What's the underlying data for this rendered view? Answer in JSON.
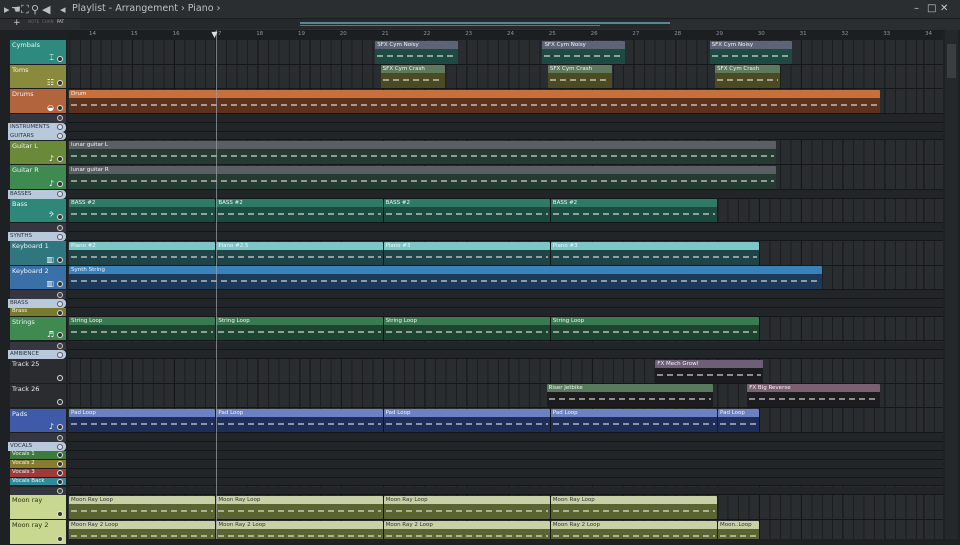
{
  "titlebar": {
    "title": "Playlist - Arrangement › Piano ›",
    "toolbar_labels": [
      "NOTE",
      "CHAN",
      "PAT"
    ]
  },
  "ruler": {
    "bars": [
      14,
      15,
      16,
      17,
      18,
      19,
      20,
      21,
      22,
      23,
      24,
      25,
      26,
      27,
      28,
      29,
      30,
      31,
      32,
      33,
      34
    ]
  },
  "playhead_bar": 17,
  "tracks": [
    {
      "kind": "track",
      "name": "Cymbals",
      "color": "#2e8a7e",
      "icon": "cymbal-icon",
      "glyph": "⌶"
    },
    {
      "kind": "track",
      "name": "Toms",
      "color": "#8a8a3c",
      "icon": "toms-icon",
      "glyph": "☷"
    },
    {
      "kind": "track",
      "name": "Drums",
      "color": "#b2643c",
      "icon": "drum-icon",
      "glyph": "◒"
    },
    {
      "kind": "spacer"
    },
    {
      "kind": "group",
      "name": "INSTRUMENTS"
    },
    {
      "kind": "group",
      "name": "GUITARS"
    },
    {
      "kind": "track",
      "name": "Guitar L",
      "color": "#6a8a3a",
      "icon": "guitar-icon",
      "glyph": "♪"
    },
    {
      "kind": "track",
      "name": "Guitar R",
      "color": "#3f8a50",
      "icon": "guitar-icon",
      "glyph": "♪"
    },
    {
      "kind": "group",
      "name": "BASSES"
    },
    {
      "kind": "track",
      "name": "Bass",
      "color": "#2f877a",
      "icon": "bass-clef-icon",
      "glyph": "𝄢"
    },
    {
      "kind": "spacer"
    },
    {
      "kind": "group",
      "name": "SYNTHS"
    },
    {
      "kind": "track",
      "name": "Keyboard 1",
      "color": "#2f767e",
      "icon": "keyboard-icon",
      "glyph": "▥"
    },
    {
      "kind": "track",
      "name": "Keyboard 2",
      "color": "#3a70a8",
      "icon": "keyboard-icon",
      "glyph": "▥"
    },
    {
      "kind": "spacer"
    },
    {
      "kind": "group",
      "name": "BRASS"
    },
    {
      "kind": "small",
      "name": "Brass",
      "color": "#7a7a2c"
    },
    {
      "kind": "track",
      "name": "Strings",
      "color": "#3f8a50",
      "icon": "violin-icon",
      "glyph": "♬"
    },
    {
      "kind": "spacer"
    },
    {
      "kind": "group",
      "name": "AMBIENCE"
    },
    {
      "kind": "track",
      "name": "Track 25",
      "color": "#2a2c2f"
    },
    {
      "kind": "track",
      "name": "Track 26",
      "color": "#2a2c2f"
    },
    {
      "kind": "track",
      "name": "Pads",
      "color": "#3f5aa8",
      "icon": "note-icon",
      "glyph": "♪"
    },
    {
      "kind": "spacer"
    },
    {
      "kind": "group",
      "name": "VOCALS"
    },
    {
      "kind": "small",
      "name": "Vocals 1",
      "color": "#3f7a3a"
    },
    {
      "kind": "small",
      "name": "Vocals 2",
      "color": "#8a7a2c"
    },
    {
      "kind": "small",
      "name": "Vocals 3",
      "color": "#a03a3a"
    },
    {
      "kind": "small",
      "name": "Vocals Back",
      "color": "#2f8a9a"
    },
    {
      "kind": "spacer"
    },
    {
      "kind": "track",
      "name": "Moon ray",
      "color": "#c8d890",
      "dark": true
    },
    {
      "kind": "track",
      "name": "Moon ray 2",
      "color": "#c8d890",
      "dark": true
    }
  ],
  "clips": [
    {
      "track": 0,
      "label": "SFX Cym Noisy",
      "start": 20.8,
      "end": 22.8,
      "hd": "#5e6478",
      "bd": "#1f4a44"
    },
    {
      "track": 0,
      "label": "SFX Cym Noisy",
      "start": 24.8,
      "end": 26.8,
      "hd": "#5e6478",
      "bd": "#1f4a44"
    },
    {
      "track": 0,
      "label": "SFX Cym Noisy",
      "start": 28.8,
      "end": 30.8,
      "hd": "#5e6478",
      "bd": "#1f4a44"
    },
    {
      "track": 1,
      "label": "SFX Cym Crash",
      "start": 20.93,
      "end": 22.5,
      "hd": "#5e7a5c",
      "bd": "#4c4a22"
    },
    {
      "track": 1,
      "label": "SFX Cym Crash",
      "start": 24.93,
      "end": 26.5,
      "hd": "#5e7a5c",
      "bd": "#4c4a22"
    },
    {
      "track": 1,
      "label": "SFX Cym Crash",
      "start": 28.93,
      "end": 30.5,
      "hd": "#5e7a5c",
      "bd": "#4c4a22"
    },
    {
      "track": 2,
      "label": "Drum",
      "start": 13.45,
      "end": 32.9,
      "hd": "#c8703c",
      "bd": "#5a321e"
    },
    {
      "track": 6,
      "label": "lunar guitar L",
      "start": 13.45,
      "end": 30.4,
      "hd": "#5a5f63",
      "bd": "#253a30"
    },
    {
      "track": 7,
      "label": "lunar guitar R",
      "start": 13.45,
      "end": 30.4,
      "hd": "#5a5f63",
      "bd": "#253a30"
    },
    {
      "track": 9,
      "label": "BASS #2",
      "start": 13.45,
      "end": 17,
      "hd": "#2f7a66",
      "bd": "#1c4a40"
    },
    {
      "track": 9,
      "label": "BASS #2",
      "start": 17,
      "end": 21,
      "hd": "#2f7a66",
      "bd": "#1c4a40"
    },
    {
      "track": 9,
      "label": "BASS #2",
      "start": 21,
      "end": 25,
      "hd": "#2f7a66",
      "bd": "#1c4a40"
    },
    {
      "track": 9,
      "label": "BASS #2",
      "start": 25,
      "end": 29,
      "hd": "#2f7a66",
      "bd": "#1c4a40"
    },
    {
      "track": 12,
      "label": "Piano #2",
      "start": 13.45,
      "end": 17,
      "hd": "#7cc6c8",
      "bd": "#1f4448"
    },
    {
      "track": 12,
      "label": "Piano #2.5",
      "start": 17,
      "end": 21,
      "hd": "#7cc6c8",
      "bd": "#1f4448"
    },
    {
      "track": 12,
      "label": "Piano #3",
      "start": 21,
      "end": 25,
      "hd": "#7cc6c8",
      "bd": "#1f4448"
    },
    {
      "track": 12,
      "label": "Piano #3",
      "start": 25,
      "end": 30,
      "hd": "#7cc6c8",
      "bd": "#1f4448"
    },
    {
      "track": 13,
      "label": "Synth String",
      "start": 13.45,
      "end": 31.5,
      "hd": "#3a82bc",
      "bd": "#1c3a58"
    },
    {
      "track": 17,
      "label": "String Loop",
      "start": 13.45,
      "end": 17,
      "hd": "#3a7a52",
      "bd": "#1e4430"
    },
    {
      "track": 17,
      "label": "String Loop",
      "start": 17,
      "end": 21,
      "hd": "#3a7a52",
      "bd": "#1e4430"
    },
    {
      "track": 17,
      "label": "String Loop",
      "start": 21,
      "end": 25,
      "hd": "#3a7a52",
      "bd": "#1e4430"
    },
    {
      "track": 17,
      "label": "String Loop",
      "start": 25,
      "end": 30,
      "hd": "#3a7a52",
      "bd": "#1e4430"
    },
    {
      "track": 20,
      "label": "FX Mech Growl",
      "start": 27.5,
      "end": 30.1,
      "hd": "#6e5e78",
      "bd": "#1c1c1e"
    },
    {
      "track": 21,
      "label": "Riser Jetbike",
      "start": 24.9,
      "end": 28.9,
      "hd": "#5a7a5e",
      "bd": "#1c1c1e"
    },
    {
      "track": 21,
      "label": "FX Big Reverse",
      "start": 29.7,
      "end": 32.9,
      "hd": "#7a6070",
      "bd": "#1c1c1e"
    },
    {
      "track": 22,
      "label": "Pad Loop",
      "start": 13.45,
      "end": 17,
      "hd": "#6c80c4",
      "bd": "#1f2e58"
    },
    {
      "track": 22,
      "label": "Pad Loop",
      "start": 17,
      "end": 21,
      "hd": "#6c80c4",
      "bd": "#1f2e58"
    },
    {
      "track": 22,
      "label": "Pad Loop",
      "start": 21,
      "end": 25,
      "hd": "#6c80c4",
      "bd": "#1f2e58"
    },
    {
      "track": 22,
      "label": "Pad Loop",
      "start": 25,
      "end": 29,
      "hd": "#6c80c4",
      "bd": "#1f2e58"
    },
    {
      "track": 22,
      "label": "Pad Loop",
      "start": 29,
      "end": 30,
      "hd": "#6c80c4",
      "bd": "#1f2e58"
    },
    {
      "track": 30,
      "label": "Moon Ray Loop",
      "start": 13.45,
      "end": 17,
      "hd": "#c8d0a8",
      "bd": "#5a6430",
      "dark": true
    },
    {
      "track": 30,
      "label": "Moon Ray Loop",
      "start": 17,
      "end": 21,
      "hd": "#c8d0a8",
      "bd": "#5a6430",
      "dark": true
    },
    {
      "track": 30,
      "label": "Moon Ray Loop",
      "start": 21,
      "end": 25,
      "hd": "#c8d0a8",
      "bd": "#5a6430",
      "dark": true
    },
    {
      "track": 30,
      "label": "Moon Ray Loop",
      "start": 25,
      "end": 29,
      "hd": "#c8d0a8",
      "bd": "#5a6430",
      "dark": true
    },
    {
      "track": 31,
      "label": "Moon Ray 2 Loop",
      "start": 13.45,
      "end": 17,
      "hd": "#c8d0a8",
      "bd": "#5a6430",
      "dark": true
    },
    {
      "track": 31,
      "label": "Moon Ray 2 Loop",
      "start": 17,
      "end": 21,
      "hd": "#c8d0a8",
      "bd": "#5a6430",
      "dark": true
    },
    {
      "track": 31,
      "label": "Moon Ray 2 Loop",
      "start": 21,
      "end": 25,
      "hd": "#c8d0a8",
      "bd": "#5a6430",
      "dark": true
    },
    {
      "track": 31,
      "label": "Moon Ray 2 Loop",
      "start": 25,
      "end": 29,
      "hd": "#c8d0a8",
      "bd": "#5a6430",
      "dark": true
    },
    {
      "track": 31,
      "label": "Moon..Loop",
      "start": 29,
      "end": 30,
      "hd": "#c8d0a8",
      "bd": "#5a6430",
      "dark": true
    }
  ]
}
